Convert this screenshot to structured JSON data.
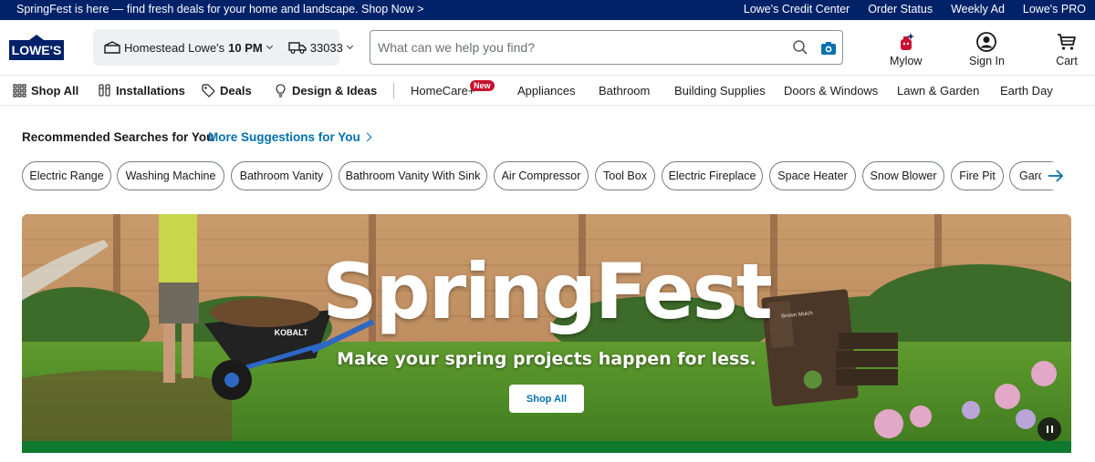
{
  "topbar": {
    "promo": "SpringFest is here — find fresh deals for your home and landscape. Shop Now >",
    "links": [
      "Lowe's Credit Center",
      "Order Status",
      "Weekly Ad",
      "Lowe's PRO"
    ]
  },
  "header": {
    "logo_text": "LOWE'S",
    "store_name": "Homestead Lowe's",
    "store_hours": "10 PM",
    "zip": "33033",
    "search_placeholder": "What can we help you find?",
    "search_value": "",
    "actions": {
      "mylow": "Mylow",
      "signin": "Sign In",
      "cart": "Cart"
    }
  },
  "nav": {
    "shop_all": "Shop All",
    "installations": "Installations",
    "deals": "Deals",
    "design": "Design & Ideas",
    "homecare": "HomeCare+",
    "homecare_badge": "New",
    "appliances": "Appliances",
    "bathroom": "Bathroom",
    "building": "Building Supplies",
    "doors": "Doors & Windows",
    "lawn": "Lawn & Garden",
    "earth": "Earth Day"
  },
  "recommended": {
    "title": "Recommended Searches for You",
    "more": "More Suggestions for You",
    "chips": [
      "Electric Range",
      "Washing Machine",
      "Bathroom Vanity",
      "Bathroom Vanity With Sink",
      "Air Compressor",
      "Tool Box",
      "Electric Fireplace",
      "Space Heater",
      "Snow Blower",
      "Fire Pit",
      "Garden"
    ]
  },
  "hero": {
    "title": "SpringFest",
    "subtitle": "Make your spring projects happen for less.",
    "button": "Shop All",
    "wheelbarrow_brand": "KOBALT",
    "mulch_bag": "Brown Mulch"
  },
  "colors": {
    "brand_navy": "#012169",
    "link_blue": "#0471af",
    "badge_red": "#c8102e",
    "hero_green": "#0f7a2e"
  }
}
